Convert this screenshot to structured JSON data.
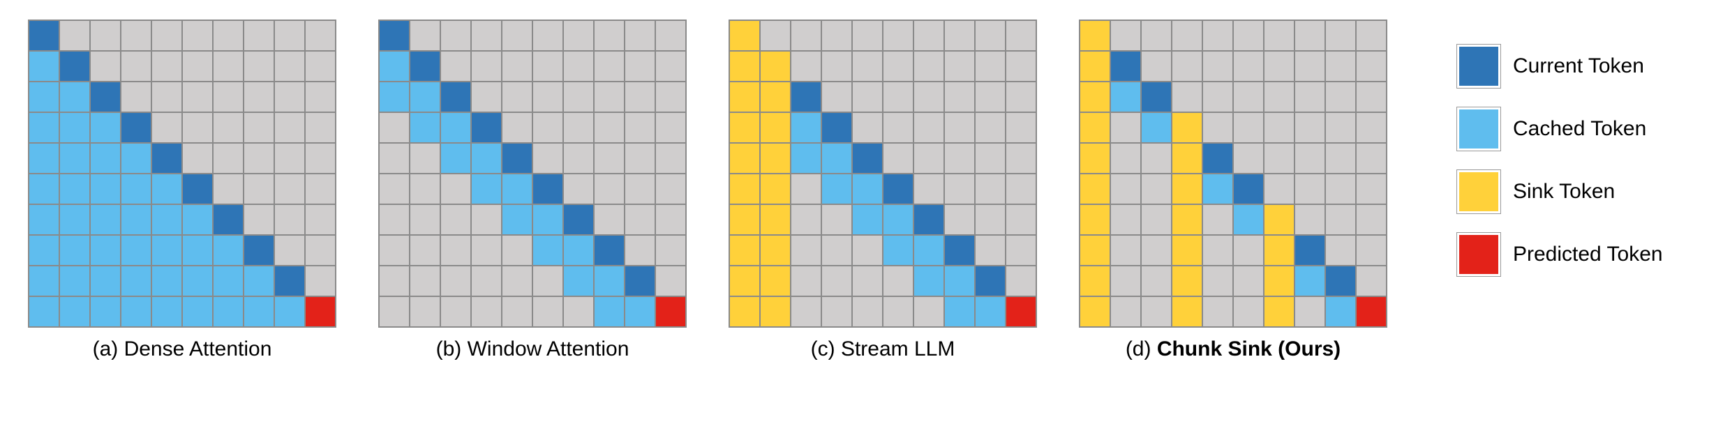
{
  "grid_size": 10,
  "captions": {
    "a": "(a) Dense Attention",
    "b": "(b) Window Attention",
    "c": "(c) Stream LLM",
    "d": "(d) Chunk Sink (Ours)"
  },
  "legend": {
    "curr": "Current Token",
    "cache": "Cached Token",
    "sink": "Sink Token",
    "pred": "Predicted Token"
  },
  "colors": {
    "none": "#d0cece",
    "curr": "#2e75b6",
    "cache": "#5fbdee",
    "sink": "#ffd13a",
    "pred": "#e32219"
  },
  "chart_data": [
    {
      "name": "Dense Attention",
      "type": "heatmap",
      "rows": 10,
      "cols": 10,
      "cells": [
        [
          "curr",
          "none",
          "none",
          "none",
          "none",
          "none",
          "none",
          "none",
          "none",
          "none"
        ],
        [
          "cache",
          "curr",
          "none",
          "none",
          "none",
          "none",
          "none",
          "none",
          "none",
          "none"
        ],
        [
          "cache",
          "cache",
          "curr",
          "none",
          "none",
          "none",
          "none",
          "none",
          "none",
          "none"
        ],
        [
          "cache",
          "cache",
          "cache",
          "curr",
          "none",
          "none",
          "none",
          "none",
          "none",
          "none"
        ],
        [
          "cache",
          "cache",
          "cache",
          "cache",
          "curr",
          "none",
          "none",
          "none",
          "none",
          "none"
        ],
        [
          "cache",
          "cache",
          "cache",
          "cache",
          "cache",
          "curr",
          "none",
          "none",
          "none",
          "none"
        ],
        [
          "cache",
          "cache",
          "cache",
          "cache",
          "cache",
          "cache",
          "curr",
          "none",
          "none",
          "none"
        ],
        [
          "cache",
          "cache",
          "cache",
          "cache",
          "cache",
          "cache",
          "cache",
          "curr",
          "none",
          "none"
        ],
        [
          "cache",
          "cache",
          "cache",
          "cache",
          "cache",
          "cache",
          "cache",
          "cache",
          "curr",
          "none"
        ],
        [
          "cache",
          "cache",
          "cache",
          "cache",
          "cache",
          "cache",
          "cache",
          "cache",
          "cache",
          "pred"
        ]
      ]
    },
    {
      "name": "Window Attention",
      "type": "heatmap",
      "rows": 10,
      "cols": 10,
      "cells": [
        [
          "curr",
          "none",
          "none",
          "none",
          "none",
          "none",
          "none",
          "none",
          "none",
          "none"
        ],
        [
          "cache",
          "curr",
          "none",
          "none",
          "none",
          "none",
          "none",
          "none",
          "none",
          "none"
        ],
        [
          "cache",
          "cache",
          "curr",
          "none",
          "none",
          "none",
          "none",
          "none",
          "none",
          "none"
        ],
        [
          "none",
          "cache",
          "cache",
          "curr",
          "none",
          "none",
          "none",
          "none",
          "none",
          "none"
        ],
        [
          "none",
          "none",
          "cache",
          "cache",
          "curr",
          "none",
          "none",
          "none",
          "none",
          "none"
        ],
        [
          "none",
          "none",
          "none",
          "cache",
          "cache",
          "curr",
          "none",
          "none",
          "none",
          "none"
        ],
        [
          "none",
          "none",
          "none",
          "none",
          "cache",
          "cache",
          "curr",
          "none",
          "none",
          "none"
        ],
        [
          "none",
          "none",
          "none",
          "none",
          "none",
          "cache",
          "cache",
          "curr",
          "none",
          "none"
        ],
        [
          "none",
          "none",
          "none",
          "none",
          "none",
          "none",
          "cache",
          "cache",
          "curr",
          "none"
        ],
        [
          "none",
          "none",
          "none",
          "none",
          "none",
          "none",
          "none",
          "cache",
          "cache",
          "pred"
        ]
      ]
    },
    {
      "name": "Stream LLM",
      "type": "heatmap",
      "rows": 10,
      "cols": 10,
      "cells": [
        [
          "sink",
          "none",
          "none",
          "none",
          "none",
          "none",
          "none",
          "none",
          "none",
          "none"
        ],
        [
          "sink",
          "sink",
          "none",
          "none",
          "none",
          "none",
          "none",
          "none",
          "none",
          "none"
        ],
        [
          "sink",
          "sink",
          "curr",
          "none",
          "none",
          "none",
          "none",
          "none",
          "none",
          "none"
        ],
        [
          "sink",
          "sink",
          "cache",
          "curr",
          "none",
          "none",
          "none",
          "none",
          "none",
          "none"
        ],
        [
          "sink",
          "sink",
          "cache",
          "cache",
          "curr",
          "none",
          "none",
          "none",
          "none",
          "none"
        ],
        [
          "sink",
          "sink",
          "none",
          "cache",
          "cache",
          "curr",
          "none",
          "none",
          "none",
          "none"
        ],
        [
          "sink",
          "sink",
          "none",
          "none",
          "cache",
          "cache",
          "curr",
          "none",
          "none",
          "none"
        ],
        [
          "sink",
          "sink",
          "none",
          "none",
          "none",
          "cache",
          "cache",
          "curr",
          "none",
          "none"
        ],
        [
          "sink",
          "sink",
          "none",
          "none",
          "none",
          "none",
          "cache",
          "cache",
          "curr",
          "none"
        ],
        [
          "sink",
          "sink",
          "none",
          "none",
          "none",
          "none",
          "none",
          "cache",
          "cache",
          "pred"
        ]
      ]
    },
    {
      "name": "Chunk Sink (Ours)",
      "type": "heatmap",
      "rows": 10,
      "cols": 10,
      "cells": [
        [
          "sink",
          "none",
          "none",
          "none",
          "none",
          "none",
          "none",
          "none",
          "none",
          "none"
        ],
        [
          "sink",
          "curr",
          "none",
          "none",
          "none",
          "none",
          "none",
          "none",
          "none",
          "none"
        ],
        [
          "sink",
          "cache",
          "curr",
          "none",
          "none",
          "none",
          "none",
          "none",
          "none",
          "none"
        ],
        [
          "sink",
          "none",
          "cache",
          "sink",
          "none",
          "none",
          "none",
          "none",
          "none",
          "none"
        ],
        [
          "sink",
          "none",
          "none",
          "sink",
          "curr",
          "none",
          "none",
          "none",
          "none",
          "none"
        ],
        [
          "sink",
          "none",
          "none",
          "sink",
          "cache",
          "curr",
          "none",
          "none",
          "none",
          "none"
        ],
        [
          "sink",
          "none",
          "none",
          "sink",
          "none",
          "cache",
          "sink",
          "none",
          "none",
          "none"
        ],
        [
          "sink",
          "none",
          "none",
          "sink",
          "none",
          "none",
          "sink",
          "curr",
          "none",
          "none"
        ],
        [
          "sink",
          "none",
          "none",
          "sink",
          "none",
          "none",
          "sink",
          "cache",
          "curr",
          "none"
        ],
        [
          "sink",
          "none",
          "none",
          "sink",
          "none",
          "none",
          "sink",
          "none",
          "cache",
          "pred"
        ]
      ]
    }
  ]
}
